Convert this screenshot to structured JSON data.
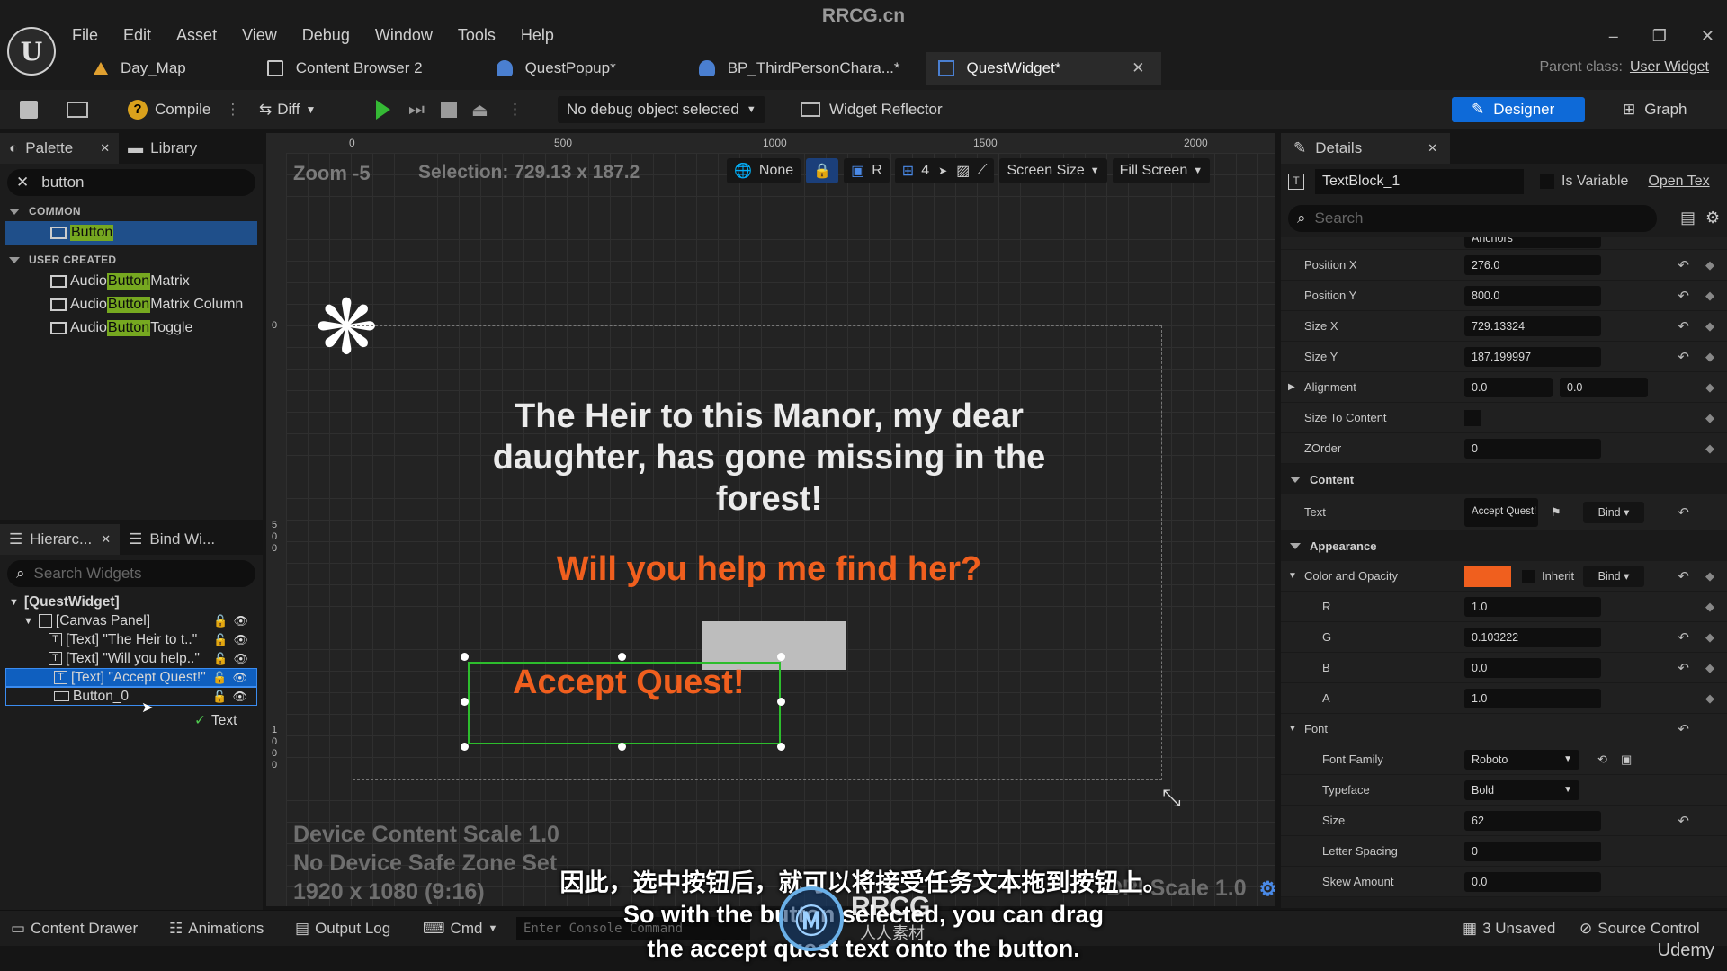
{
  "app": {
    "title": "RRCG.cn",
    "logo": "U",
    "menu": [
      "File",
      "Edit",
      "Asset",
      "View",
      "Debug",
      "Window",
      "Tools",
      "Help"
    ],
    "window_controls": [
      "–",
      "❐",
      "✕"
    ]
  },
  "tabs": [
    {
      "label": "Day_Map",
      "icon": "map-icon",
      "color": "#e0a030"
    },
    {
      "label": "Content Browser 2",
      "icon": "folder-icon",
      "color": "#c8c8c8"
    },
    {
      "label": "QuestPopup*",
      "icon": "widget-icon",
      "color": "#4a7fd0"
    },
    {
      "label": "BP_ThirdPersonChara...*",
      "icon": "character-icon",
      "color": "#4a7fd0"
    },
    {
      "label": "QuestWidget*",
      "icon": "widget-blueprint-icon",
      "color": "#4a7fd0",
      "active": true
    }
  ],
  "parent_class": {
    "label": "Parent class:",
    "value": "User Widget"
  },
  "toolbar": {
    "compile": "Compile",
    "diff": "Diff",
    "debug_object": "No debug object selected",
    "widget_reflector": "Widget Reflector",
    "designer": "Designer",
    "graph": "Graph"
  },
  "palette": {
    "tab_palette": "Palette",
    "tab_library": "Library",
    "search_value": "button",
    "common_header": "COMMON",
    "common_items": [
      {
        "before": "",
        "hl": "Button",
        "after": ""
      }
    ],
    "user_header": "USER CREATED",
    "user_items": [
      {
        "before": "Audio ",
        "hl": "Button",
        "after": " Matrix"
      },
      {
        "before": "Audio ",
        "hl": "Button",
        "after": " Matrix Column"
      },
      {
        "before": "Audio ",
        "hl": "Button",
        "after": " Toggle"
      }
    ]
  },
  "hierarchy": {
    "tab_hierarchy": "Hierarc...",
    "tab_bind": "Bind Wi...",
    "search_placeholder": "Search Widgets",
    "items": [
      {
        "label": "[QuestWidget]",
        "indent": 0
      },
      {
        "label": "[Canvas Panel]",
        "indent": 1
      },
      {
        "label": "[Text] \"The Heir to t..\"",
        "indent": 2
      },
      {
        "label": "[Text] \"Will you help..\"",
        "indent": 2
      },
      {
        "label": "[Text] \"Accept Quest!\"",
        "indent": 2
      },
      {
        "label": "Button_0",
        "indent": 2
      }
    ],
    "drag_hint": "Text"
  },
  "designer": {
    "zoom": "Zoom -5",
    "selection": "Selection: 729.13 x 187.2",
    "ruler_top": [
      "0",
      "500",
      "1000",
      "1500",
      "2000"
    ],
    "ruler_left": [
      "0",
      "500",
      "1000"
    ],
    "tools": {
      "none": "None",
      "r": "R",
      "grid_num": "4",
      "screen_size": "Screen Size",
      "fill_screen": "Fill Screen"
    },
    "main_text": "The Heir to this Manor, my dear daughter, has gone missing in the forest!",
    "sub_text": "Will you help me find her?",
    "accept_text": "Accept Quest!",
    "device_info": [
      "Device Content Scale 1.0",
      "No Device Safe Zone Set",
      "1920 x 1080 (9:16)"
    ],
    "dpi_scale": "DPI Scale 1.0",
    "colors": {
      "orange": "#f05f1e",
      "selection": "#2dbd2d"
    }
  },
  "details": {
    "title": "Details",
    "widget_name": "TextBlock_1",
    "is_variable": "Is Variable",
    "open_text": "Open Tex",
    "search_placeholder": "Search",
    "anchors_value": "Anchors",
    "position_x": {
      "label": "Position X",
      "value": "276.0"
    },
    "position_y": {
      "label": "Position Y",
      "value": "800.0"
    },
    "size_x": {
      "label": "Size X",
      "value": "729.13324"
    },
    "size_y": {
      "label": "Size Y",
      "value": "187.199997"
    },
    "alignment": {
      "label": "Alignment",
      "v1": "0.0",
      "v2": "0.0"
    },
    "size_to_content": "Size To Content",
    "zorder": {
      "label": "ZOrder",
      "value": "0"
    },
    "content_header": "Content",
    "text": {
      "label": "Text",
      "value": "Accept Quest!",
      "bind": "Bind"
    },
    "appearance_header": "Appearance",
    "color_opacity": {
      "label": "Color and Opacity",
      "inherit": "Inherit",
      "bind": "Bind",
      "swatch": "#f05f1e"
    },
    "r": {
      "label": "R",
      "value": "1.0"
    },
    "g": {
      "label": "G",
      "value": "0.103222"
    },
    "b": {
      "label": "B",
      "value": "0.0"
    },
    "a": {
      "label": "A",
      "value": "1.0"
    },
    "font_header": "Font",
    "font_family": {
      "label": "Font Family",
      "value": "Roboto"
    },
    "typeface": {
      "label": "Typeface",
      "value": "Bold"
    },
    "size": {
      "label": "Size",
      "value": "62"
    },
    "letter_spacing": {
      "label": "Letter Spacing",
      "value": "0"
    },
    "skew": {
      "label": "Skew Amount",
      "value": "0.0"
    }
  },
  "bottombar": {
    "content_drawer": "Content Drawer",
    "animations": "Animations",
    "output_log": "Output Log",
    "cmd": "Cmd",
    "console_placeholder": "Enter Console Command",
    "unsaved": "3 Unsaved",
    "source_control": "Source Control"
  },
  "subtitles": {
    "cn": "因此，选中按钮后，就可以将接受任务文本拖到按钮上。",
    "en1": "So with the button selected, you can drag",
    "en2": "the accept quest text onto the button."
  },
  "watermark": {
    "text": "RRCG",
    "cn": "人人素材",
    "udemy": "Udemy"
  }
}
